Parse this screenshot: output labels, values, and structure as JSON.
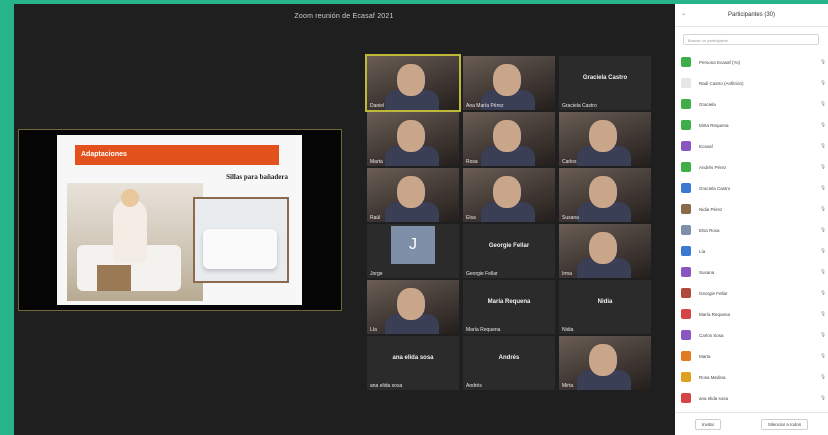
{
  "window": {
    "title": "Zoom reunión de Ecasaf 2021"
  },
  "share": {
    "slide_title": "Adaptaciones",
    "slide_subtitle": "Sillas para bañadera"
  },
  "gallery": {
    "tiles": [
      {
        "name": "Daniel",
        "kind": "video",
        "active": true
      },
      {
        "name": "Ana María Pérez",
        "kind": "video"
      },
      {
        "name": "Graciela Castro",
        "kind": "name",
        "center": "Graciela Castro"
      },
      {
        "name": "Marta",
        "kind": "video"
      },
      {
        "name": "Rosa",
        "kind": "video"
      },
      {
        "name": "Carlos",
        "kind": "video"
      },
      {
        "name": "Raúl",
        "kind": "video"
      },
      {
        "name": "Elsa",
        "kind": "video"
      },
      {
        "name": "Susana",
        "kind": "video"
      },
      {
        "name": "Jorge",
        "kind": "avatar",
        "initial": "J"
      },
      {
        "name": "Georgie Fellar",
        "kind": "name",
        "center": "Georgie Fellar"
      },
      {
        "name": "Irma",
        "kind": "video"
      },
      {
        "name": "Lía",
        "kind": "video"
      },
      {
        "name": "María Requena",
        "kind": "name",
        "center": "María Requena"
      },
      {
        "name": "Nidia",
        "kind": "name",
        "center": "Nidia"
      },
      {
        "name": "ana elida sosa",
        "kind": "name",
        "center": "ana elida sosa"
      },
      {
        "name": "Andrés",
        "kind": "name",
        "center": "Andrés"
      },
      {
        "name": "Mirta",
        "kind": "video"
      }
    ]
  },
  "panel": {
    "title": "Participantes (30)",
    "search_placeholder": "Buscar un participante",
    "participants": [
      {
        "name": "Persona Ecasaf (Yo)",
        "color": "#3fae49"
      },
      {
        "name": "Raúl Castro (Anfitrión)",
        "color": "#e6e6e6"
      },
      {
        "name": "Graciela",
        "color": "#3fae49"
      },
      {
        "name": "Mirta Requena",
        "color": "#3fae49"
      },
      {
        "name": "Ecasaf",
        "color": "#8a56c2"
      },
      {
        "name": "Andrés Pérez",
        "color": "#3fae49"
      },
      {
        "name": "Graciela Castro",
        "color": "#3b78d1"
      },
      {
        "name": "Nidia Pérez",
        "color": "#8a6a4a"
      },
      {
        "name": "Elsa Rosa",
        "color": "#7d90a8"
      },
      {
        "name": "Lía",
        "color": "#3b78d1"
      },
      {
        "name": "Susana",
        "color": "#8a56c2"
      },
      {
        "name": "Georgie Fellar",
        "color": "#b04a3a"
      },
      {
        "name": "María Requena",
        "color": "#d64545"
      },
      {
        "name": "Carlos Sosa",
        "color": "#8a56c2"
      },
      {
        "name": "Marta",
        "color": "#e07b1f"
      },
      {
        "name": "Rosa Medina",
        "color": "#e0a01f"
      },
      {
        "name": "ana elida sosa",
        "color": "#d64545"
      }
    ],
    "invite_label": "Invitar",
    "mute_all_label": "Silenciar a todos"
  }
}
